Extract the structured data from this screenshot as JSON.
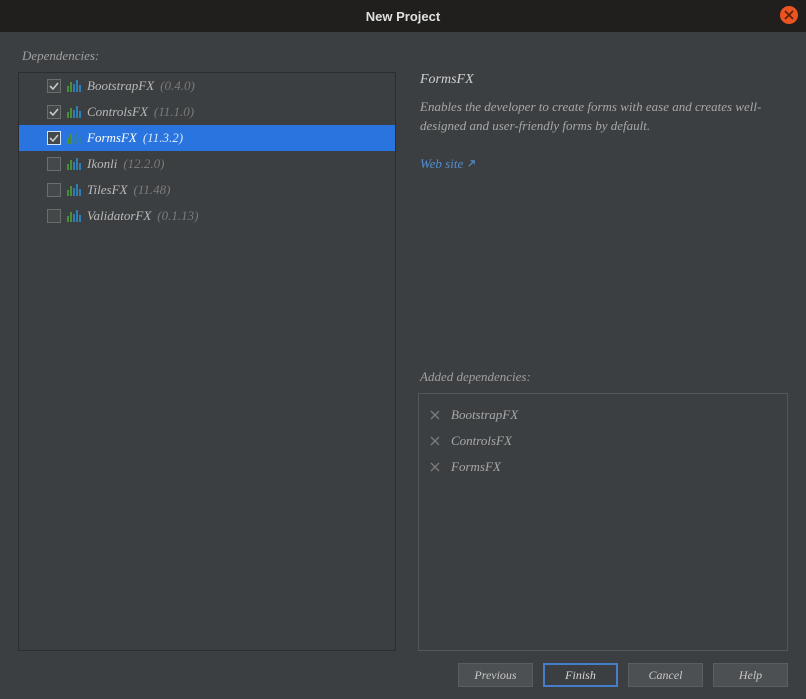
{
  "titlebar": {
    "title": "New Project"
  },
  "labels": {
    "dependencies": "Dependencies:",
    "added": "Added dependencies:"
  },
  "dependencies": [
    {
      "name": "BootstrapFX",
      "version": "(0.4.0)",
      "checked": true,
      "selected": false
    },
    {
      "name": "ControlsFX",
      "version": "(11.1.0)",
      "checked": true,
      "selected": false
    },
    {
      "name": "FormsFX",
      "version": "(11.3.2)",
      "checked": true,
      "selected": true
    },
    {
      "name": "Ikonli",
      "version": "(12.2.0)",
      "checked": false,
      "selected": false
    },
    {
      "name": "TilesFX",
      "version": "(11.48)",
      "checked": false,
      "selected": false
    },
    {
      "name": "ValidatorFX",
      "version": "(0.1.13)",
      "checked": false,
      "selected": false
    }
  ],
  "detail": {
    "title": "FormsFX",
    "description": "Enables the developer to create forms with ease and creates well-designed and user-friendly forms by default.",
    "website_label": "Web site"
  },
  "added": [
    {
      "name": "BootstrapFX"
    },
    {
      "name": "ControlsFX"
    },
    {
      "name": "FormsFX"
    }
  ],
  "buttons": {
    "previous": "Previous",
    "finish": "Finish",
    "cancel": "Cancel",
    "help": "Help"
  }
}
